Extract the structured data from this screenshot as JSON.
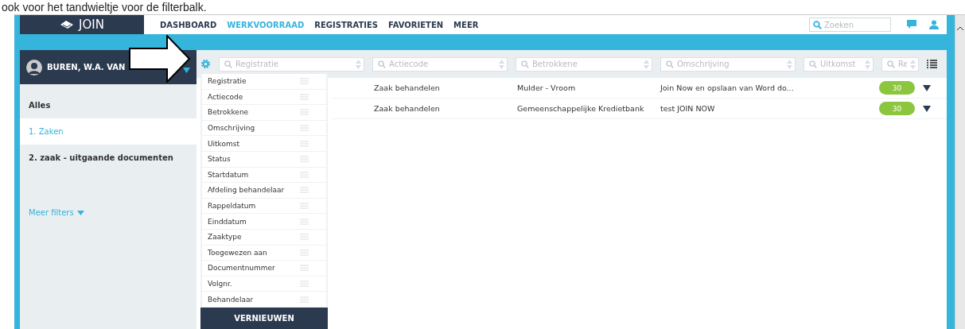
{
  "caption": "ook voor het tandwieltje voor de filterbalk.",
  "header": {
    "logo": "JOIN",
    "nav": [
      {
        "label": "DASHBOARD",
        "selected": false
      },
      {
        "label": "WERKVOORRAAD",
        "selected": true
      },
      {
        "label": "REGISTRATIES",
        "selected": false
      },
      {
        "label": "FAVORIETEN",
        "selected": false
      },
      {
        "label": "MEER",
        "selected": false
      }
    ],
    "search": {
      "placeholder": "Zoeken"
    }
  },
  "sidebar": {
    "user": "BUREN, W.A. VAN",
    "items": [
      {
        "label": "Alles",
        "selected": false
      },
      {
        "label": "1. Zaken",
        "selected": true
      },
      {
        "label": "2. zaak - uitgaande documenten",
        "selected": false
      }
    ],
    "more_filters": "Meer filters"
  },
  "filters": [
    {
      "placeholder": "Registratie"
    },
    {
      "placeholder": "Actiecode"
    },
    {
      "placeholder": "Betrokkene"
    },
    {
      "placeholder": "Omschrijving"
    },
    {
      "placeholder": "Uitkomst"
    },
    {
      "placeholder": "Re"
    }
  ],
  "column_menu": {
    "items": [
      "Registratie",
      "Actiecode",
      "Betrokkene",
      "Omschrijving",
      "Uitkomst",
      "Status",
      "Startdatum",
      "Afdeling behandelaar",
      "Rappeldatum",
      "Einddatum",
      "Zaaktype",
      "Toegewezen aan",
      "Documentnummer",
      "Volgnr.",
      "Behandelaar"
    ],
    "button": "VERNIEUWEN"
  },
  "rows": [
    {
      "cells": [
        "Zaak behandelen",
        "Mulder - Vroom",
        "Join Now en opslaan van Word do..."
      ],
      "badge": "30"
    },
    {
      "cells": [
        "Zaak behandelen",
        "Gemeenschappelijke Kredietbank",
        "test JOIN NOW"
      ],
      "badge": "30"
    }
  ]
}
